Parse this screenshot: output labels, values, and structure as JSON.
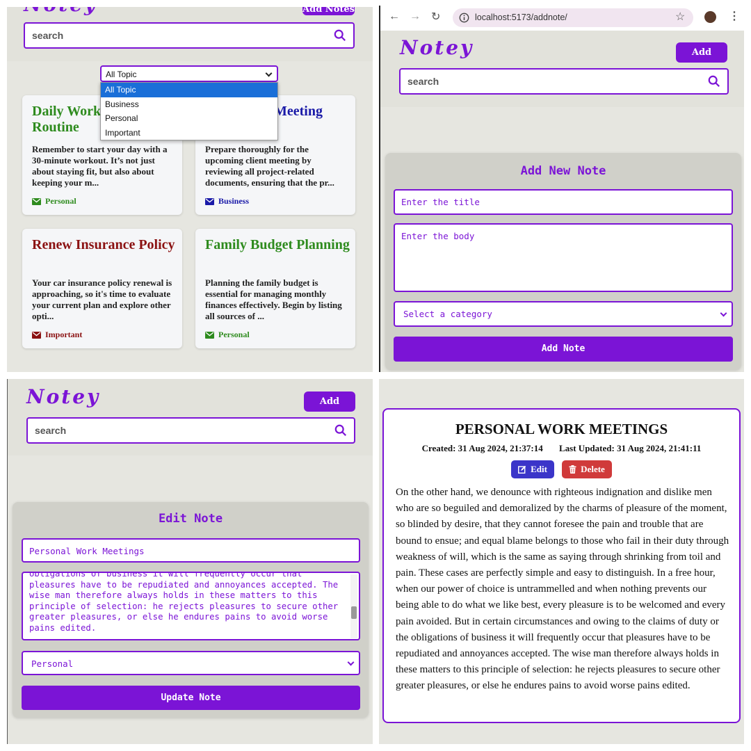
{
  "app": {
    "logo": "Notey",
    "add_notes_label": "Add Notes",
    "search_placeholder": "search"
  },
  "colors": {
    "accent": "#7b14d6",
    "personal": "#2e8b1e",
    "business": "#1a1aa8",
    "important": "#8b1212",
    "edit": "#3b35c9",
    "delete": "#d03a3a"
  },
  "list_view": {
    "topic_select": {
      "selected": "All Topic",
      "options": [
        "All Topic",
        "Business",
        "Personal",
        "Important"
      ]
    },
    "cards": [
      {
        "title": "Daily Work Routine",
        "title_visible": [
          "Daily Work",
          "Routine"
        ],
        "body": "Remember to start your day with a 30-minute workout. It’s not just about staying fit, but also about keeping your m...",
        "category": "Personal"
      },
      {
        "title_visible": [
          "Meeting"
        ],
        "body": "Prepare thoroughly for the upcoming client meeting by reviewing all project-related documents, ensuring that the pr...",
        "category": "Business"
      },
      {
        "title": "Renew Insurance Policy",
        "body": "Your car insurance policy renewal is approaching, so it's time to evaluate your current plan and explore other opti...",
        "category": "Important"
      },
      {
        "title": "Family Budget Planning",
        "body": "Planning the family budget is essential for managing monthly finances effectively. Begin by listing all sources of ...",
        "category": "Personal"
      }
    ]
  },
  "add_view": {
    "url": "localhost:5173/addnote/",
    "heading": "Add New Note",
    "title_placeholder": "Enter the title",
    "body_placeholder": "Enter the body",
    "category_placeholder": "Select a category",
    "submit_label": "Add Note"
  },
  "edit_view": {
    "heading": "Edit Note",
    "title_value": "Personal Work Meetings",
    "body_visible": "obligations of business it will frequently occur that\npleasures have to be repudiated and annoyances accepted. The\nwise man therefore always holds in these matters to this\nprinciple of selection: he rejects pleasures to secure other\ngreater pleasures, or else he endures pains to avoid worse\npains edited.",
    "category_value": "Personal",
    "submit_label": "Update Note"
  },
  "detail_view": {
    "title": "PERSONAL WORK MEETINGS",
    "created": "Created: 31 Aug 2024, 21:37:14",
    "updated": "Last Updated: 31 Aug 2024, 21:41:11",
    "edit_label": "Edit",
    "delete_label": "Delete",
    "body": "On the other hand, we denounce with righteous indignation and dislike men who are so beguiled and demoralized by the charms of pleasure of the moment, so blinded by desire, that they cannot foresee the pain and trouble that are bound to ensue; and equal blame belongs to those who fail in their duty through weakness of will, which is the same as saying through shrinking from toil and pain. These cases are perfectly simple and easy to distinguish. In a free hour, when our power of choice is untrammelled and when nothing prevents our being able to do what we like best, every pleasure is to be welcomed and every pain avoided. But in certain circumstances and owing to the claims of duty or the obligations of business it will frequently occur that pleasures have to be repudiated and annoyances accepted. The wise man therefore always holds in these matters to this principle of selection: he rejects pleasures to secure other greater pleasures, or else he endures pains to avoid worse pains edited."
  }
}
